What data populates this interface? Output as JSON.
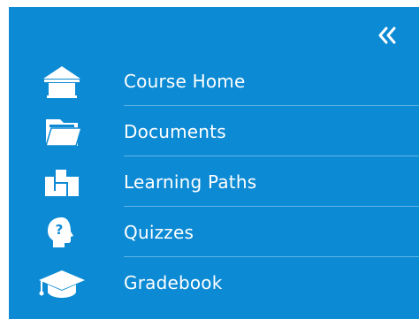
{
  "sidebar": {
    "background": "#0c8ad4",
    "collapse_icon": "double-chevron-left-icon",
    "items": [
      {
        "label": "Course Home",
        "icon": "home-icon"
      },
      {
        "label": "Documents",
        "icon": "folder-icon"
      },
      {
        "label": "Learning Paths",
        "icon": "learning-paths-icon"
      },
      {
        "label": "Quizzes",
        "icon": "quiz-head-icon"
      },
      {
        "label": "Gradebook",
        "icon": "graduation-cap-icon"
      }
    ]
  }
}
